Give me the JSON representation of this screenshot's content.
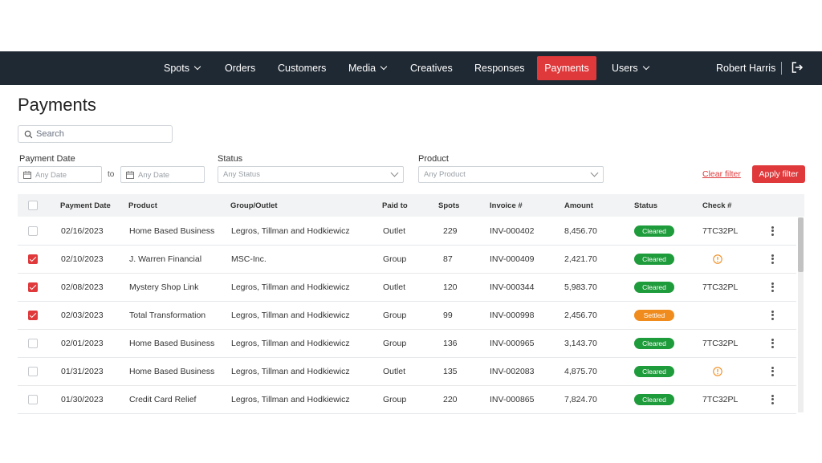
{
  "nav": {
    "items": [
      {
        "label": "Spots",
        "dropdown": true
      },
      {
        "label": "Orders",
        "dropdown": false
      },
      {
        "label": "Customers",
        "dropdown": false
      },
      {
        "label": "Media",
        "dropdown": true
      },
      {
        "label": "Creatives",
        "dropdown": false
      },
      {
        "label": "Responses",
        "dropdown": false
      },
      {
        "label": "Payments",
        "dropdown": false,
        "active": true
      },
      {
        "label": "Users",
        "dropdown": true
      }
    ],
    "user_name": "Robert Harris",
    "logout_icon": "logout-icon"
  },
  "page": {
    "title": "Payments"
  },
  "search": {
    "placeholder": "Search",
    "icon": "search-icon"
  },
  "filters": {
    "payment_date_label": "Payment Date",
    "date_from_placeholder": "Any Date",
    "to_label": "to",
    "date_to_placeholder": "Any Date",
    "status_label": "Status",
    "status_placeholder": "Any Status",
    "product_label": "Product",
    "product_placeholder": "Any Product",
    "clear_label": "Clear filter",
    "apply_label": "Apply filter"
  },
  "table": {
    "headers": {
      "payment_date": "Payment Date",
      "product": "Product",
      "group": "Group/Outlet",
      "paid_to": "Paid to",
      "spots": "Spots",
      "invoice": "Invoice #",
      "amount": "Amount",
      "status": "Status",
      "check": "Check #"
    },
    "rows": [
      {
        "checked": false,
        "date": "02/16/2023",
        "product": "Home Based Business",
        "group": "Legros, Tillman and Hodkiewicz",
        "paid_to": "Outlet",
        "spots": "229",
        "invoice": "INV-000402",
        "amount": "8,456.70",
        "status": "Cleared",
        "check": "7TC32PL",
        "warning": false
      },
      {
        "checked": true,
        "date": "02/10/2023",
        "product": "J. Warren Financial",
        "group": "MSC-Inc.",
        "paid_to": "Group",
        "spots": "87",
        "invoice": "INV-000409",
        "amount": "2,421.70",
        "status": "Cleared",
        "check": "",
        "warning": true
      },
      {
        "checked": true,
        "date": "02/08/2023",
        "product": "Mystery Shop Link",
        "group": "Legros, Tillman and Hodkiewicz",
        "paid_to": "Outlet",
        "spots": "120",
        "invoice": "INV-000344",
        "amount": "5,983.70",
        "status": "Cleared",
        "check": "7TC32PL",
        "warning": false
      },
      {
        "checked": true,
        "date": "02/03/2023",
        "product": "Total Transformation",
        "group": "Legros, Tillman and Hodkiewicz",
        "paid_to": "Group",
        "spots": "99",
        "invoice": "INV-000998",
        "amount": "2,456.70",
        "status": "Settled",
        "check": "",
        "warning": false
      },
      {
        "checked": false,
        "date": "02/01/2023",
        "product": "Home Based Business",
        "group": "Legros, Tillman and Hodkiewicz",
        "paid_to": "Group",
        "spots": "136",
        "invoice": "INV-000965",
        "amount": "3,143.70",
        "status": "Cleared",
        "check": "7TC32PL",
        "warning": false
      },
      {
        "checked": false,
        "date": "01/31/2023",
        "product": "Home Based Business",
        "group": "Legros, Tillman and Hodkiewicz",
        "paid_to": "Outlet",
        "spots": "135",
        "invoice": "INV-002083",
        "amount": "4,875.70",
        "status": "Cleared",
        "check": "",
        "warning": true
      },
      {
        "checked": false,
        "date": "01/30/2023",
        "product": "Credit Card Relief",
        "group": "Legros, Tillman and Hodkiewicz",
        "paid_to": "Group",
        "spots": "220",
        "invoice": "INV-000865",
        "amount": "7,824.70",
        "status": "Cleared",
        "check": "7TC32PL",
        "warning": false
      }
    ]
  },
  "colors": {
    "nav_bg": "#1f2933",
    "accent": "#e0393b",
    "cleared": "#1e9b3b",
    "settled": "#f08c1d",
    "warning": "#f08c1d"
  }
}
